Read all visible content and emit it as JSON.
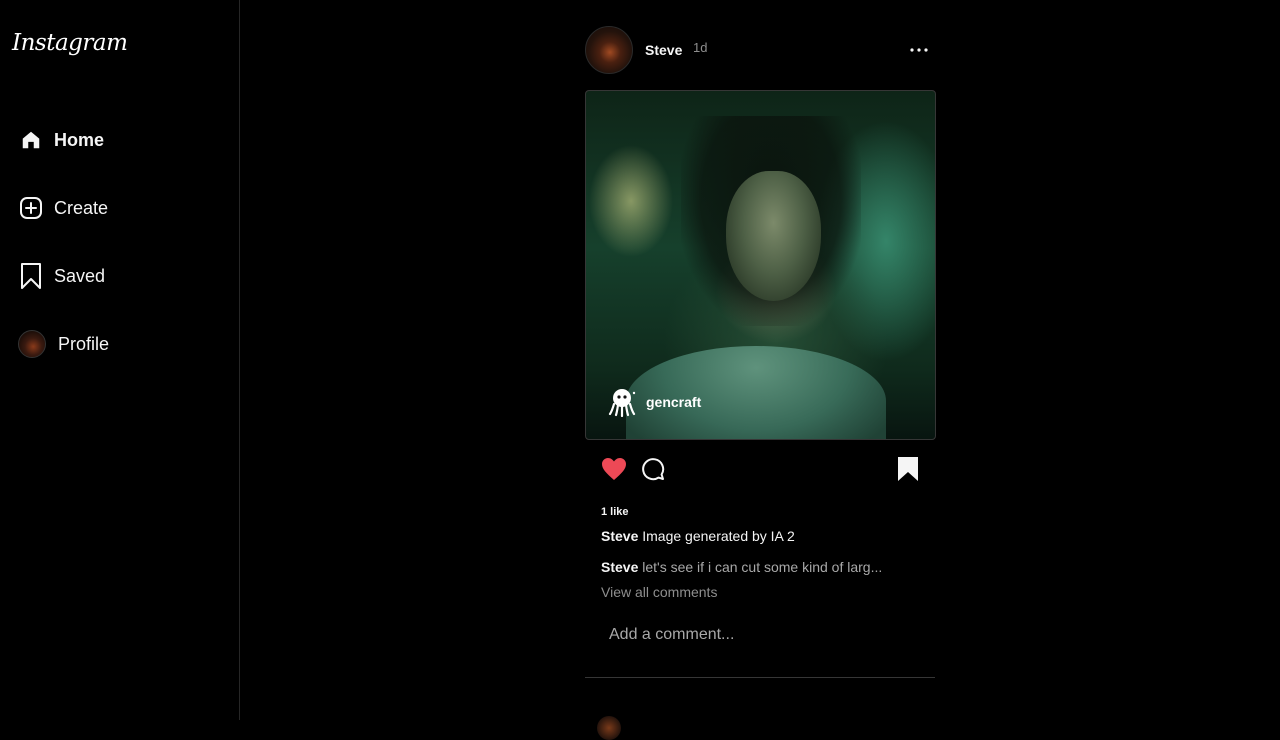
{
  "app": {
    "logo_text": "Instagram"
  },
  "sidebar": {
    "items": [
      {
        "label": "Home",
        "icon": "home-icon",
        "active": true
      },
      {
        "label": "Create",
        "icon": "plus-square-icon",
        "active": false
      },
      {
        "label": "Saved",
        "icon": "bookmark-icon",
        "active": false
      },
      {
        "label": "Profile",
        "icon": "avatar",
        "active": false
      }
    ]
  },
  "post": {
    "username": "Steve",
    "time_ago": "1d",
    "image": {
      "watermark_text": "gencraft"
    },
    "liked": true,
    "like_color": "#ed4956",
    "likes_text": "1 like",
    "caption": {
      "username": "Steve",
      "text": "Image generated by IA 2"
    },
    "comment": {
      "username": "Steve",
      "text": "let's see if i can cut some kind of larg..."
    },
    "view_all_label": "View all comments",
    "add_comment_placeholder": "Add a comment..."
  }
}
